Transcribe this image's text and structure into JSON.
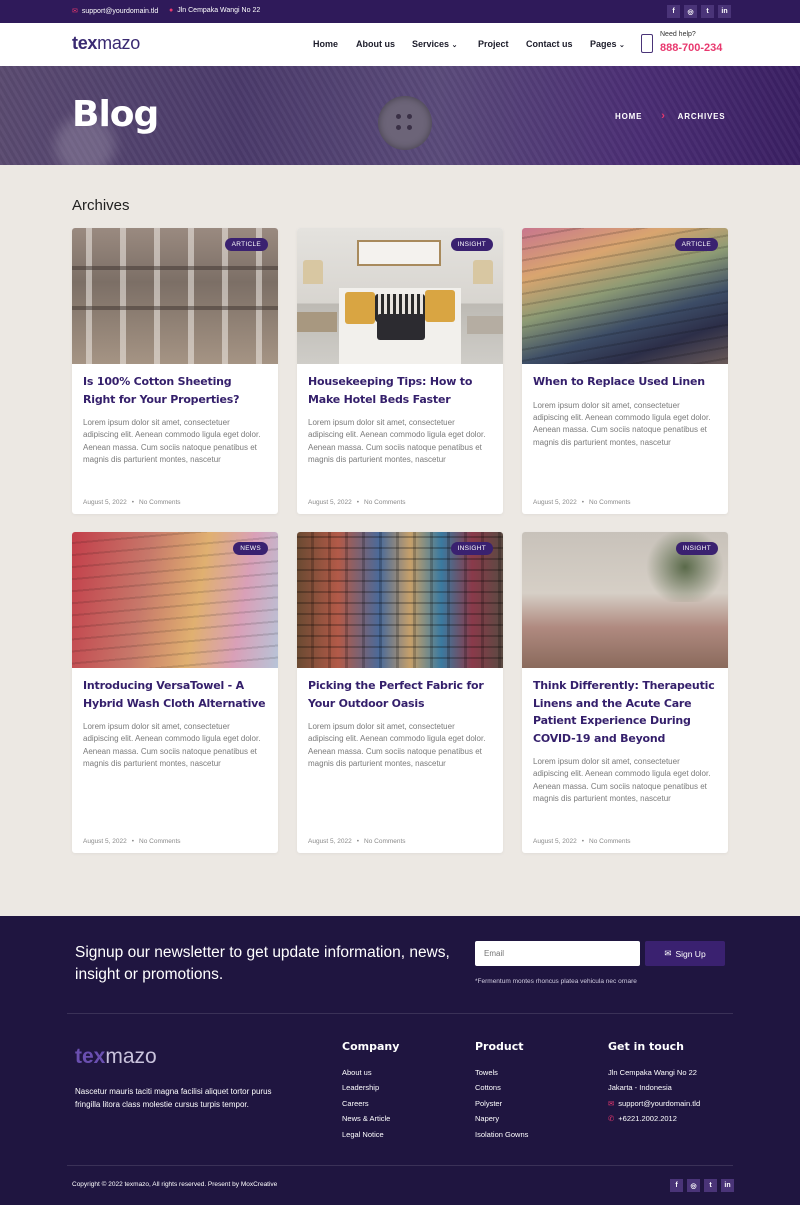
{
  "topbar": {
    "email": "support@yourdomain.tld",
    "address": "Jln Cempaka Wangi No 22",
    "socials": [
      "f",
      "ig",
      "tw",
      "in"
    ]
  },
  "header": {
    "logo_a": "tex",
    "logo_b": "mazo",
    "nav": [
      "Home",
      "About us",
      "Services",
      "Project",
      "Contact us",
      "Pages"
    ],
    "need_help": "Need help?",
    "phone": "888-700-234"
  },
  "hero": {
    "title": "Blog",
    "crumb_home": "HOME",
    "crumb_current": "ARCHIVES"
  },
  "section_title": "Archives",
  "posts": [
    {
      "badge": "ARTICLE",
      "title": "Is 100% Cotton Sheeting Right for Your Properties?",
      "excerpt": "Lorem ipsum dolor sit amet, consectetuer adipiscing elit. Aenean commodo ligula eget dolor. Aenean massa. Cum sociis natoque penatibus et magnis dis parturient montes, nascetur",
      "date": "August 5, 2022",
      "comments": "No Comments"
    },
    {
      "badge": "INSIGHT",
      "title": "Housekeeping Tips: How to Make Hotel Beds Faster",
      "excerpt": "Lorem ipsum dolor sit amet, consectetuer adipiscing elit. Aenean commodo ligula eget dolor. Aenean massa. Cum sociis natoque penatibus et magnis dis parturient montes, nascetur",
      "date": "August 5, 2022",
      "comments": "No Comments"
    },
    {
      "badge": "ARTICLE",
      "title": "When to Replace Used Linen",
      "excerpt": "Lorem ipsum dolor sit amet, consectetuer adipiscing elit. Aenean commodo ligula eget dolor. Aenean massa. Cum sociis natoque penatibus et magnis dis parturient montes, nascetur",
      "date": "August 5, 2022",
      "comments": "No Comments"
    },
    {
      "badge": "NEWS",
      "title": "Introducing VersaTowel - A Hybrid Wash Cloth Alternative",
      "excerpt": "Lorem ipsum dolor sit amet, consectetuer adipiscing elit. Aenean commodo ligula eget dolor. Aenean massa. Cum sociis natoque penatibus et magnis dis parturient montes, nascetur",
      "date": "August 5, 2022",
      "comments": "No Comments"
    },
    {
      "badge": "INSIGHT",
      "title": "Picking the Perfect Fabric for Your Outdoor Oasis",
      "excerpt": "Lorem ipsum dolor sit amet, consectetuer adipiscing elit. Aenean commodo ligula eget dolor. Aenean massa. Cum sociis natoque penatibus et magnis dis parturient montes, nascetur",
      "date": "August 5, 2022",
      "comments": "No Comments"
    },
    {
      "badge": "INSIGHT",
      "title": "Think Differently: Therapeutic Linens and the Acute Care Patient Experience During COVID-19 and Beyond",
      "excerpt": "Lorem ipsum dolor sit amet, consectetuer adipiscing elit. Aenean commodo ligula eget dolor. Aenean massa. Cum sociis natoque penatibus et magnis dis parturient montes, nascetur",
      "date": "August 5, 2022",
      "comments": "No Comments"
    }
  ],
  "footer": {
    "newsletter_text": "Signup our newsletter to get update information, news, insight or promotions.",
    "email_placeholder": "Email",
    "signup_label": "Sign Up",
    "note": "*Fermentum montes rhoncus platea vehicula nec ornare",
    "logo_a": "tex",
    "logo_b": "mazo",
    "description": "Nascetur mauris taciti magna facilisi aliquet tortor purus fringilla litora class molestie cursus turpis tempor.",
    "company_title": "Company",
    "company": [
      "About us",
      "Leadership",
      "Careers",
      "News & Article",
      "Legal Notice"
    ],
    "product_title": "Product",
    "product": [
      "Towels",
      "Cottons",
      "Polyster",
      "Napery",
      "Isolation Gowns"
    ],
    "contact_title": "Get in touch",
    "contact_address1": "Jln Cempaka Wangi No 22",
    "contact_address2": "Jakarta - Indonesia",
    "contact_email": "support@yourdomain.tld",
    "contact_phone": "+6221.2002.2012",
    "copyright": "Copyright © 2022 texmazo, All rights reserved. Present by MoxCreative"
  },
  "colors": {
    "brand": "#2f1a5a",
    "accent": "#e8386e",
    "footer_bg": "#1f1540"
  },
  "icons": [
    "email-icon",
    "location-icon",
    "facebook-icon",
    "instagram-icon",
    "twitter-icon",
    "linkedin-icon",
    "phone-icon",
    "chevron-down-icon",
    "chevron-right-icon",
    "envelope-icon"
  ]
}
